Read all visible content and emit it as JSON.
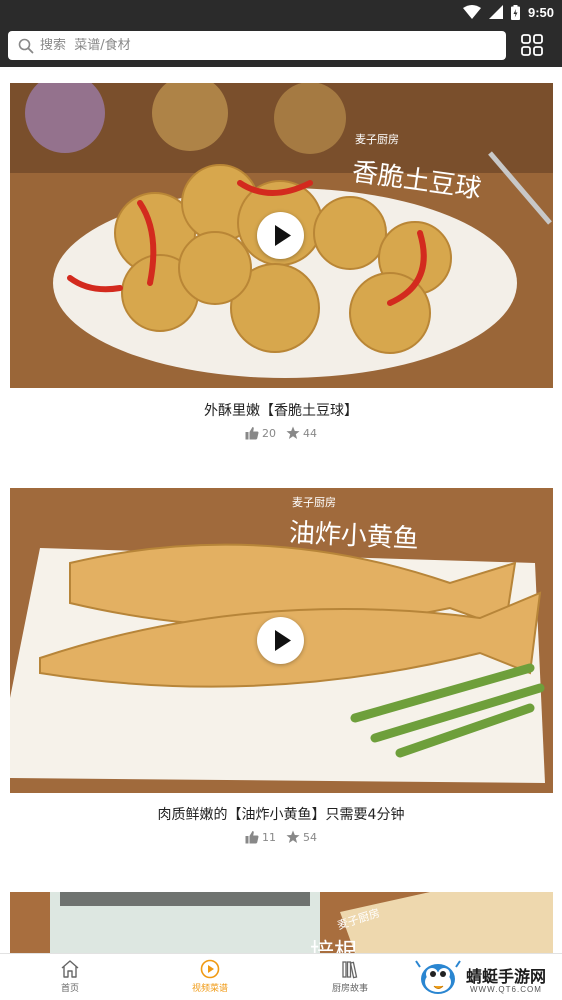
{
  "status_bar": {
    "time": "9:50"
  },
  "search": {
    "placeholder": "搜索  菜谱/食材"
  },
  "videos": [
    {
      "title": "外酥里嫩【香脆土豆球】",
      "likes": "20",
      "favorites": "44",
      "overlay_brand": "麦子厨房",
      "overlay_name": "香脆土豆球"
    },
    {
      "title": "肉质鲜嫩的【油炸小黄鱼】只需要4分钟",
      "likes": "11",
      "favorites": "54",
      "overlay_brand": "麦子厨房",
      "overlay_name": "油炸小黄鱼"
    },
    {
      "overlay_brand": "麦子厨房",
      "overlay_name": "培根"
    }
  ],
  "nav": [
    {
      "label": "首页",
      "icon": "home-icon"
    },
    {
      "label": "视频菜谱",
      "icon": "play-circle-icon",
      "active": true
    },
    {
      "label": "厨房故事",
      "icon": "books-icon"
    }
  ],
  "watermark": {
    "title": "蜻蜓手游网",
    "url": "WWW.QT6.COM"
  },
  "colors": {
    "accent": "#f09a14",
    "topbar": "#2b2b2b"
  }
}
